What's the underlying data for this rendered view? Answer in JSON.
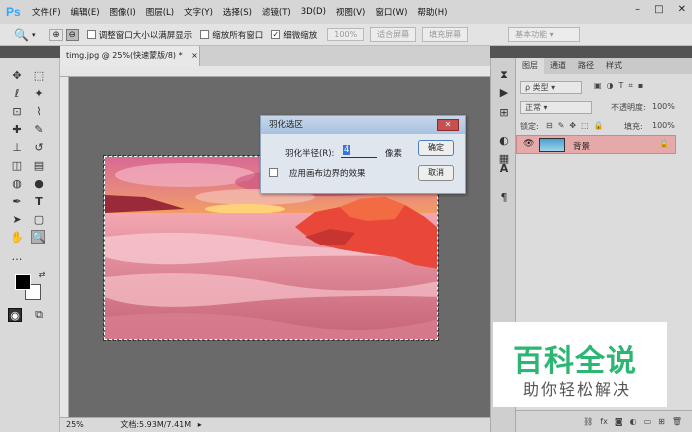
{
  "app": {
    "logo": "Ps"
  },
  "menu": [
    "文件(F)",
    "编辑(E)",
    "图像(I)",
    "图层(L)",
    "文字(Y)",
    "选择(S)",
    "滤镜(T)",
    "3D(D)",
    "视图(V)",
    "窗口(W)",
    "帮助(H)"
  ],
  "window_controls": {
    "minimize": "–",
    "maximize": "□",
    "close": "✕"
  },
  "options": {
    "resize_label": "调整窗口大小以满屏显示",
    "zoom_all_label": "缩放所有窗口",
    "scrubby_label": "细微缩放",
    "zoom_value": "100%",
    "fit_screen": "适合屏幕",
    "fill_screen": "填充屏幕",
    "workspace": "基本功能"
  },
  "document": {
    "tab_title": "timg.jpg @ 25%(快速蒙版/8) *",
    "tab_close": "×",
    "zoom": "25%",
    "doc_info": "文档:5.93M/7.41M"
  },
  "dialog": {
    "title": "羽化选区",
    "close": "✕",
    "radius_label": "羽化半径(R):",
    "radius_value": "4",
    "unit": "像素",
    "edge_label": "应用画布边界的效果",
    "ok": "确定",
    "cancel": "取消"
  },
  "panels": {
    "tabs": [
      "图层",
      "通道",
      "路径",
      "样式"
    ],
    "filter_kind": "ρ 类型",
    "blend_mode": "正常",
    "opacity_label": "不透明度:",
    "opacity_value": "100%",
    "lock_label": "锁定:",
    "fill_label": "填充:",
    "fill_value": "100%",
    "layer_name": "背景"
  },
  "watermark": {
    "title": "百科全说",
    "subtitle": "助你轻松解决"
  },
  "colors": {
    "accent": "#31a8ff",
    "layer_selected": "#e6a9a9",
    "watermark_green": "#2bb673"
  }
}
